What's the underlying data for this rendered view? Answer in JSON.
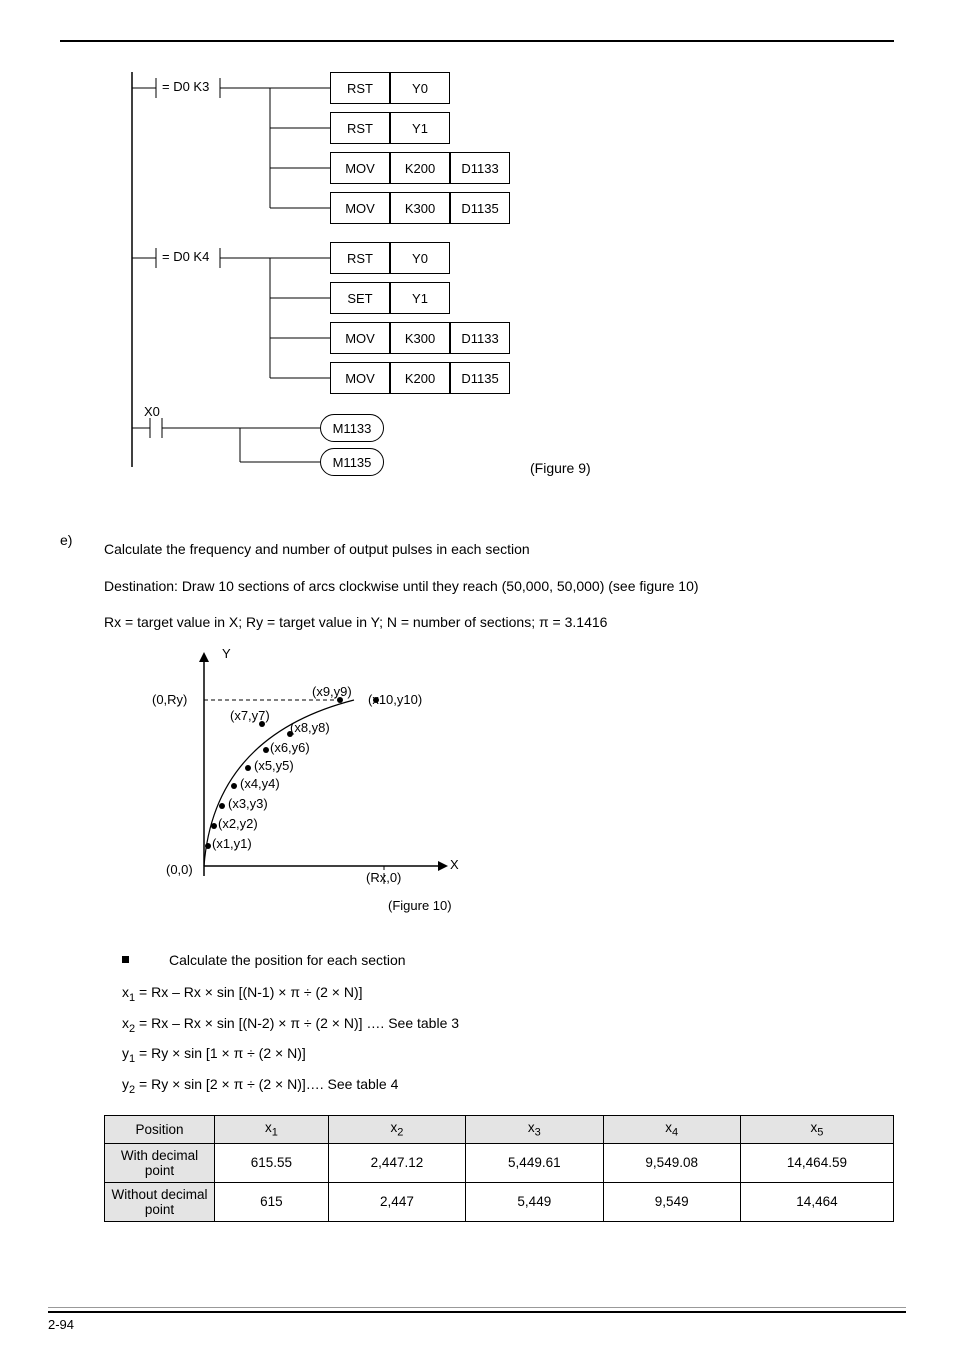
{
  "ladder": {
    "cond1": "= D0 K3",
    "cond2": "= D0 K4",
    "x0": "X0",
    "rows": [
      {
        "c1": "RST",
        "c2": "Y0",
        "c3": ""
      },
      {
        "c1": "RST",
        "c2": "Y1",
        "c3": ""
      },
      {
        "c1": "MOV",
        "c2": "K200",
        "c3": "D1133"
      },
      {
        "c1": "MOV",
        "c2": "K300",
        "c3": "D1135"
      },
      {
        "c1": "RST",
        "c2": "Y0",
        "c3": ""
      },
      {
        "c1": "SET",
        "c2": "Y1",
        "c3": ""
      },
      {
        "c1": "MOV",
        "c2": "K300",
        "c3": "D1133"
      },
      {
        "c1": "MOV",
        "c2": "K200",
        "c3": "D1135"
      }
    ],
    "m1": "M1133",
    "m2": "M1135",
    "caption": "(Figure 9)"
  },
  "e": {
    "letter": "e)",
    "line1": "Calculate the frequency and number of output pulses in each section",
    "line2": "Destination: Draw 10 sections of arcs clockwise until they reach (50,000, 50,000) (see figure 10)",
    "line3": "Rx = target value in X; Ry = target value in Y; N = number of sections; π = 3.1416",
    "bullet": "Calculate the position for each section",
    "f1_a": "x",
    "f1_b": " = Rx – Rx × sin [(N-1) × π ÷ (2 × N)]",
    "f2_a": "x",
    "f2_b": " = Rx – Rx × sin [(N-2) × π ÷ (2 × N)] …. See table 3",
    "f3_a": "y",
    "f3_b": " = Ry × sin [1 × π ÷ (2 × N)]",
    "f4_a": "y",
    "f4_b": " = Ry × sin [2 × π ÷ (2 × N)]…. See table 4",
    "fig10_caption": "(Figure 10)",
    "fig10": {
      "Y": "Y",
      "X": "X",
      "p0Ry": "(0,Ry)",
      "p9": "(x9,y9)",
      "p10": "(x10,y10)",
      "p7": "(x7,y7)",
      "p8": "(x8,y8)",
      "p6": "(x6,y6)",
      "p5": "(x5,y5)",
      "p4": "(x4,y4)",
      "p3": "(x3,y3)",
      "p2": "(x2,y2)",
      "p1": "(x1,y1)",
      "p00": "(0,0)",
      "pRx0": "(Rx,0)"
    }
  },
  "table": {
    "h0": "Position",
    "h1": "x",
    "h2": "x",
    "h3": "x",
    "h4": "x",
    "h5": "x",
    "r1": "With decimal point",
    "r2": "Without decimal point",
    "d": [
      [
        "615.55",
        "2,447.12",
        "5,449.61",
        "9,549.08",
        "14,464.59"
      ],
      [
        "615",
        "2,447",
        "5,449",
        "9,549",
        "14,464"
      ]
    ]
  },
  "chart_data": {
    "type": "table",
    "title": "Position values x1..x5",
    "categories": [
      "x1",
      "x2",
      "x3",
      "x4",
      "x5"
    ],
    "series": [
      {
        "name": "With decimal point",
        "values": [
          615.55,
          2447.12,
          5449.61,
          9549.08,
          14464.59
        ]
      },
      {
        "name": "Without decimal point",
        "values": [
          615,
          2447,
          5449,
          9549,
          14464
        ]
      }
    ]
  },
  "page_number": "2-94"
}
